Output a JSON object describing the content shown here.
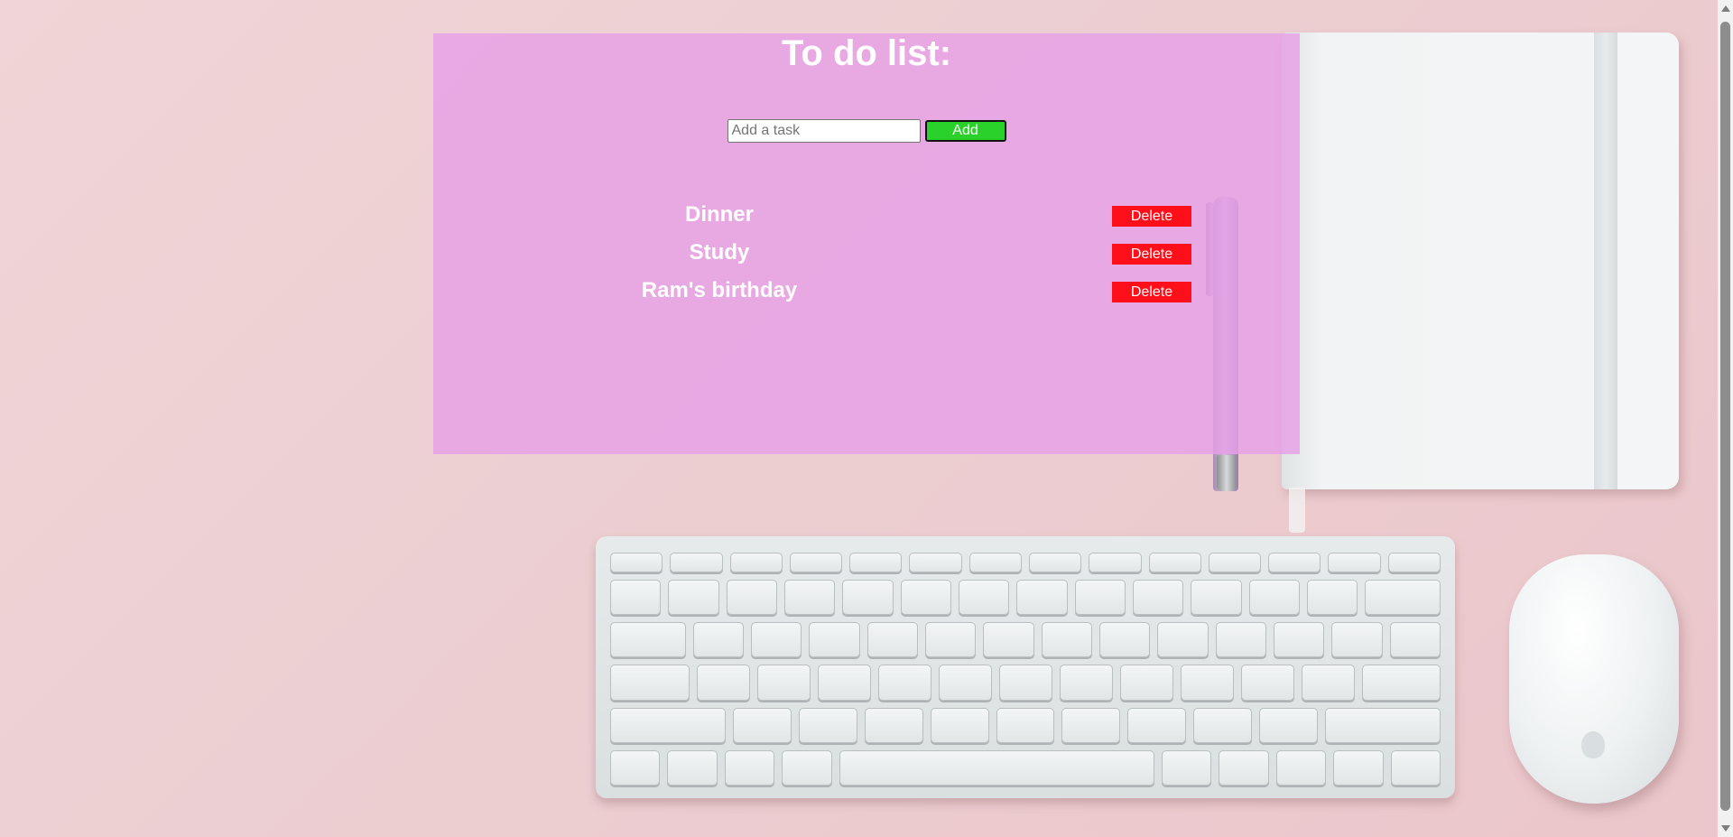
{
  "todo": {
    "title": "To do list:",
    "input_placeholder": "Add a task",
    "input_value": "",
    "add_label": "Add",
    "tasks": [
      {
        "label": "Dinner",
        "delete_label": "Delete"
      },
      {
        "label": "Study",
        "delete_label": "Delete"
      },
      {
        "label": "Ram's birthday",
        "delete_label": "Delete"
      }
    ]
  },
  "colors": {
    "panel": "#e6a0e6",
    "add_button": "#2bd12b",
    "delete_button": "#ff0f1a",
    "text": "#ffffff"
  },
  "background": {
    "icons": [
      "notebook-icon",
      "pen-icon",
      "keyboard-icon",
      "mouse-icon"
    ]
  }
}
